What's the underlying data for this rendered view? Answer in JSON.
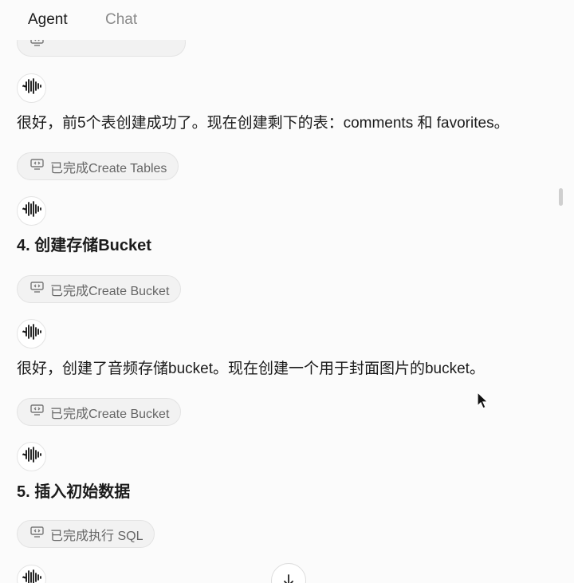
{
  "tabs": [
    {
      "label": "Agent",
      "active": true
    },
    {
      "label": "Chat",
      "active": false
    }
  ],
  "messages": {
    "text_1": "很好，前5个表创建成功了。现在创建剩下的表：comments 和 favorites。",
    "tool_1": "已完成Create Tables",
    "heading_1": "4. 创建存储Bucket",
    "tool_2": "已完成Create Bucket",
    "text_2": "很好，创建了音频存储bucket。现在创建一个用于封面图片的bucket。",
    "tool_3": "已完成Create Bucket",
    "heading_2": "5. 插入初始数据",
    "tool_4": "已完成执行 SQL"
  },
  "icons": {
    "assistant_avatar": "waveform-icon",
    "tool_status": "code-monitor-icon",
    "scroll_down": "arrow-down-icon"
  },
  "colors": {
    "background": "#fbfbfb",
    "pill_background": "#f2f2f2",
    "text": "#1b1b1b",
    "muted": "#8a8a8a"
  }
}
